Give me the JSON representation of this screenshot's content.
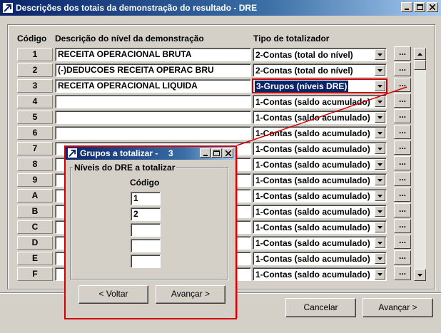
{
  "window": {
    "title": "Descrições dos totais da demonstração do resultado - DRE",
    "app_icon": "arrow-app-icon"
  },
  "columns": {
    "code": "Código",
    "description": "Descrição do nível da demonstração",
    "type": "Tipo de totalizador"
  },
  "rows": [
    {
      "code": "1",
      "description": "RECEITA OPERACIONAL BRUTA",
      "type": "2-Contas (total do nível)"
    },
    {
      "code": "2",
      "description": "(-)DEDUCOES RECEITA OPERAC BRU",
      "type": "2-Contas (total do nível)"
    },
    {
      "code": "3",
      "description": "RECEITA OPERACIONAL LIQUIDA",
      "type": "3-Grupos (níveis DRE)"
    },
    {
      "code": "4",
      "description": "",
      "type": "1-Contas (saldo acumulado)"
    },
    {
      "code": "5",
      "description": "",
      "type": "1-Contas (saldo acumulado)"
    },
    {
      "code": "6",
      "description": "",
      "type": "1-Contas (saldo acumulado)"
    },
    {
      "code": "7",
      "description": "",
      "type": "1-Contas (saldo acumulado)"
    },
    {
      "code": "8",
      "description": "",
      "type": "1-Contas (saldo acumulado)"
    },
    {
      "code": "9",
      "description": "",
      "type": "1-Contas (saldo acumulado)"
    },
    {
      "code": "A",
      "description": "",
      "type": "1-Contas (saldo acumulado)"
    },
    {
      "code": "B",
      "description": "",
      "type": "1-Contas (saldo acumulado)"
    },
    {
      "code": "C",
      "description": "",
      "type": "1-Contas (saldo acumulado)"
    },
    {
      "code": "D",
      "description": "",
      "type": "1-Contas (saldo acumulado)"
    },
    {
      "code": "E",
      "description": "",
      "type": "1-Contas (saldo acumulado)"
    },
    {
      "code": "F",
      "description": "",
      "type": "1-Contas (saldo acumulado)"
    }
  ],
  "selected_row": 3,
  "row_button_label": "...",
  "buttons": {
    "cancel": "Cancelar",
    "next": "Avançar >"
  },
  "child_dialog": {
    "title": "Grupos a totalizar -",
    "number": "3",
    "group_label": "Níveis do DRE a totalizar",
    "code_header": "Código",
    "codes": [
      "1",
      "2",
      "",
      "",
      ""
    ],
    "back": "< Voltar",
    "next": "Avançar >"
  },
  "colors": {
    "titlebar": "#0a246a",
    "highlight": "#0a246a",
    "annotation": "#d40000",
    "face": "#d4d0c8"
  }
}
